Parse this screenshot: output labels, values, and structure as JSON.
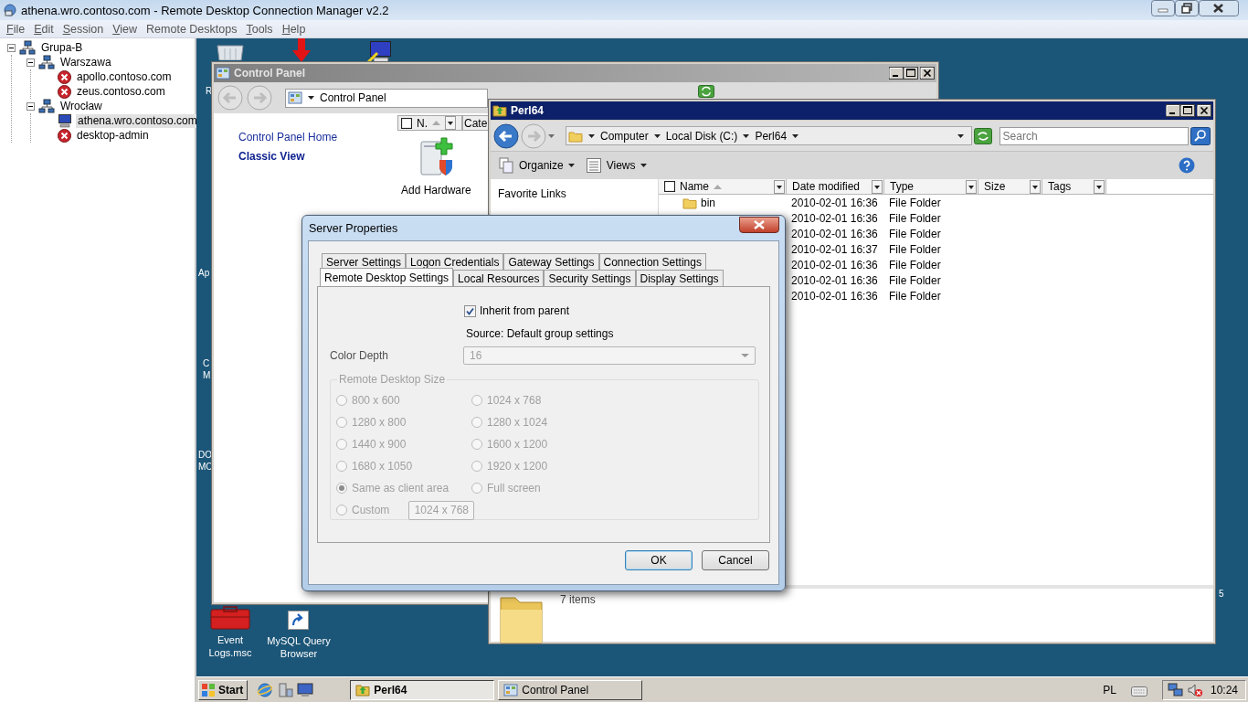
{
  "app": {
    "title": "athena.wro.contoso.com - Remote Desktop Connection Manager v2.2",
    "menu": [
      {
        "label": "File",
        "access_key": true
      },
      {
        "label": "Edit",
        "access_key": true
      },
      {
        "label": "Session",
        "access_key": true
      },
      {
        "label": "View",
        "access_key": true
      },
      {
        "label": "Remote Desktops",
        "access_key": false
      },
      {
        "label": "Tools",
        "access_key": true
      },
      {
        "label": "Help",
        "access_key": true
      }
    ]
  },
  "tree": [
    {
      "label": "Grupa-B",
      "kind": "group",
      "expanded": true,
      "selected": false,
      "children": [
        {
          "label": "Warszawa",
          "kind": "group",
          "expanded": true,
          "selected": false,
          "children": [
            {
              "label": "apollo.contoso.com",
              "kind": "server",
              "connected": false,
              "selected": false
            },
            {
              "label": "zeus.contoso.com",
              "kind": "server",
              "connected": false,
              "selected": false
            }
          ]
        },
        {
          "label": "Wrocław",
          "kind": "group",
          "expanded": true,
          "selected": false,
          "children": [
            {
              "label": "athena.wro.contoso.com",
              "kind": "server",
              "connected": true,
              "selected": true
            },
            {
              "label": "desktop-admin",
              "kind": "server",
              "connected": false,
              "selected": false
            }
          ]
        }
      ]
    }
  ],
  "desktop": {
    "icons": [
      {
        "kind": "recycle-bin"
      },
      {
        "kind": "arrow"
      },
      {
        "kind": "remote-computer"
      },
      {
        "kind": "toolbox",
        "label": "Event Logs.msc"
      },
      {
        "kind": "shortcut",
        "label": "MySQL Query Browser"
      }
    ],
    "label_fragments": [
      "R",
      "Ap",
      "C",
      "M",
      "DO",
      "MO",
      "5"
    ]
  },
  "control_panel": {
    "title": "Control Panel",
    "active": false,
    "address": "Control Panel",
    "links": [
      {
        "label": "Control Panel Home",
        "selected": false
      },
      {
        "label": "Classic View",
        "selected": true
      }
    ],
    "columns": [
      "N.",
      "Cate"
    ],
    "items": [
      {
        "label": "Add Hardware",
        "kind": "hardware"
      }
    ]
  },
  "explorer": {
    "title": "Perl64",
    "active": true,
    "path": [
      "Computer",
      "Local Disk (C:)",
      "Perl64"
    ],
    "search_placeholder": "Search",
    "toolbar": [
      {
        "label": "Organize",
        "kind": "organize"
      },
      {
        "label": "Views",
        "kind": "views"
      }
    ],
    "favorites_title": "Favorite Links",
    "columns": [
      "Name",
      "Date modified",
      "Type",
      "Size",
      "Tags"
    ],
    "rows": [
      {
        "name": "bin",
        "date_modified": "2010-02-01 16:36",
        "type": "File Folder"
      },
      {
        "date_modified": "2010-02-01 16:36",
        "type": "File Folder"
      },
      {
        "date_modified": "2010-02-01 16:36",
        "type": "File Folder"
      },
      {
        "date_modified": "2010-02-01 16:37",
        "type": "File Folder"
      },
      {
        "date_modified": "2010-02-01 16:36",
        "type": "File Folder"
      },
      {
        "date_modified": "2010-02-01 16:36",
        "type": "File Folder"
      },
      {
        "date_modified": "2010-02-01 16:36",
        "type": "File Folder"
      }
    ],
    "status": "7 items"
  },
  "dialog": {
    "title": "Server Properties",
    "tab_rows": [
      {
        "tabs": [
          {
            "label": "Server Settings",
            "selected": false
          },
          {
            "label": "Logon Credentials",
            "selected": false
          },
          {
            "label": "Gateway Settings",
            "selected": false
          },
          {
            "label": "Connection Settings",
            "selected": false
          }
        ]
      },
      {
        "tabs": [
          {
            "label": "Remote Desktop Settings",
            "selected": true
          },
          {
            "label": "Local Resources",
            "selected": false
          },
          {
            "label": "Security Settings",
            "selected": false
          },
          {
            "label": "Display Settings",
            "selected": false
          }
        ]
      }
    ],
    "inherit": {
      "label": "Inherit from parent",
      "checked": true
    },
    "source": "Source: Default group settings",
    "color_depth": {
      "label": "Color Depth",
      "value": "16",
      "disabled": true
    },
    "size_group": {
      "title": "Remote Desktop Size",
      "disabled": true,
      "options": [
        {
          "label": "800 x 600",
          "selected": false
        },
        {
          "label": "1024 x 768",
          "selected": false
        },
        {
          "label": "1280 x 800",
          "selected": false
        },
        {
          "label": "1280 x 1024",
          "selected": false
        },
        {
          "label": "1440 x 900",
          "selected": false
        },
        {
          "label": "1600 x 1200",
          "selected": false
        },
        {
          "label": "1680 x 1050",
          "selected": false
        },
        {
          "label": "1920 x 1200",
          "selected": false
        },
        {
          "label": "Same as client area",
          "selected": true
        },
        {
          "label": "Full screen",
          "selected": false
        },
        {
          "label": "Custom",
          "selected": false,
          "field_value": "1024 x 768"
        }
      ]
    },
    "buttons": [
      {
        "label": "OK",
        "default": true
      },
      {
        "label": "Cancel",
        "default": false
      }
    ]
  },
  "taskbar": {
    "start": "Start",
    "tasks": [
      {
        "label": "Perl64",
        "kind": "explorer",
        "selected": true
      },
      {
        "label": "Control Panel",
        "kind": "control-panel",
        "selected": false
      }
    ],
    "language": "PL",
    "clock": "10:24"
  }
}
